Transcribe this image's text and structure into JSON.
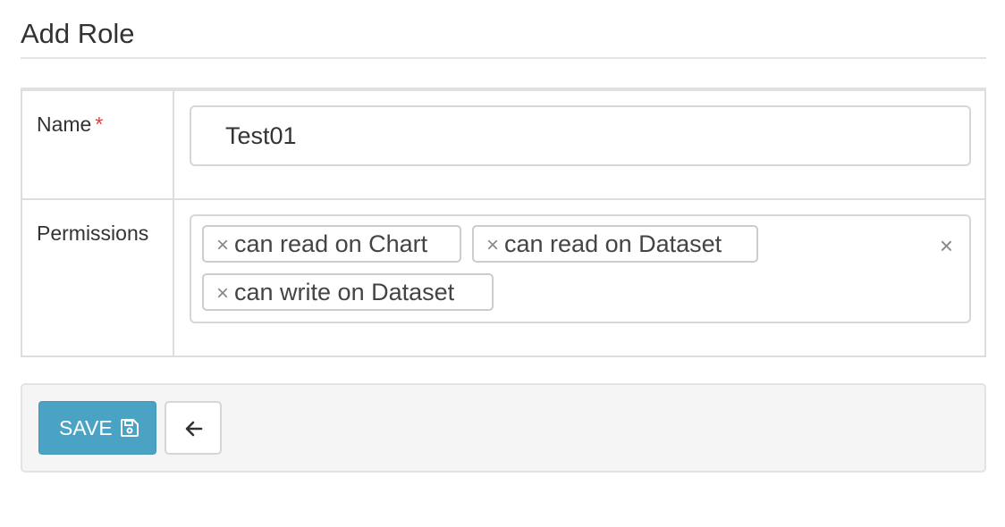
{
  "page": {
    "title": "Add Role"
  },
  "form": {
    "name": {
      "label": "Name",
      "required_marker": "*",
      "value": "Test01"
    },
    "permissions": {
      "label": "Permissions",
      "selected": [
        {
          "label": "can read on Chart",
          "remove": "×"
        },
        {
          "label": "can read on Dataset",
          "remove": "×"
        },
        {
          "label": "can write on Dataset",
          "remove": "×"
        }
      ],
      "clear_all": "×"
    }
  },
  "actions": {
    "save_label": "SAVE",
    "save_icon": "floppy-disk-icon",
    "back_icon": "arrow-left-icon"
  },
  "colors": {
    "primary": "#4aa3c4",
    "required": "#d9403b",
    "border": "#dddddd",
    "action_bar_bg": "#f5f5f5"
  }
}
